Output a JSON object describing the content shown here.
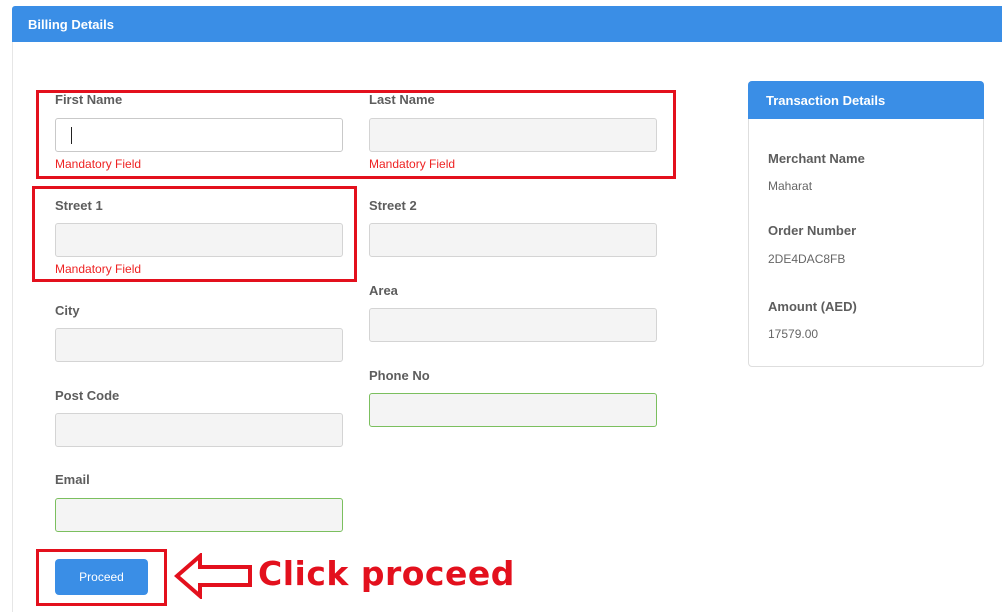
{
  "header": {
    "title": "Billing Details"
  },
  "form": {
    "first_name": {
      "label": "First Name",
      "error": "Mandatory Field",
      "value": ""
    },
    "last_name": {
      "label": "Last Name",
      "error": "Mandatory Field",
      "value": ""
    },
    "street1": {
      "label": "Street 1",
      "error": "Mandatory Field",
      "value": ""
    },
    "street2": {
      "label": "Street 2",
      "value": ""
    },
    "city": {
      "label": "City",
      "value": ""
    },
    "area": {
      "label": "Area",
      "value": ""
    },
    "post_code": {
      "label": "Post Code",
      "value": ""
    },
    "phone": {
      "label": "Phone No",
      "value": ""
    },
    "email": {
      "label": "Email",
      "value": ""
    },
    "proceed_label": "Proceed"
  },
  "transaction": {
    "title": "Transaction Details",
    "merchant_label": "Merchant Name",
    "merchant_value": "Maharat",
    "order_label": "Order Number",
    "order_value": "2DE4DAC8FB",
    "amount_label": "Amount (AED)",
    "amount_value": "17579.00"
  },
  "annotation": {
    "text": "Click proceed",
    "icon": "left-arrow-icon",
    "color": "#e3101d"
  },
  "colors": {
    "accent": "#3a8ee6",
    "error": "#e22",
    "valid_border": "#7bbf5e"
  }
}
